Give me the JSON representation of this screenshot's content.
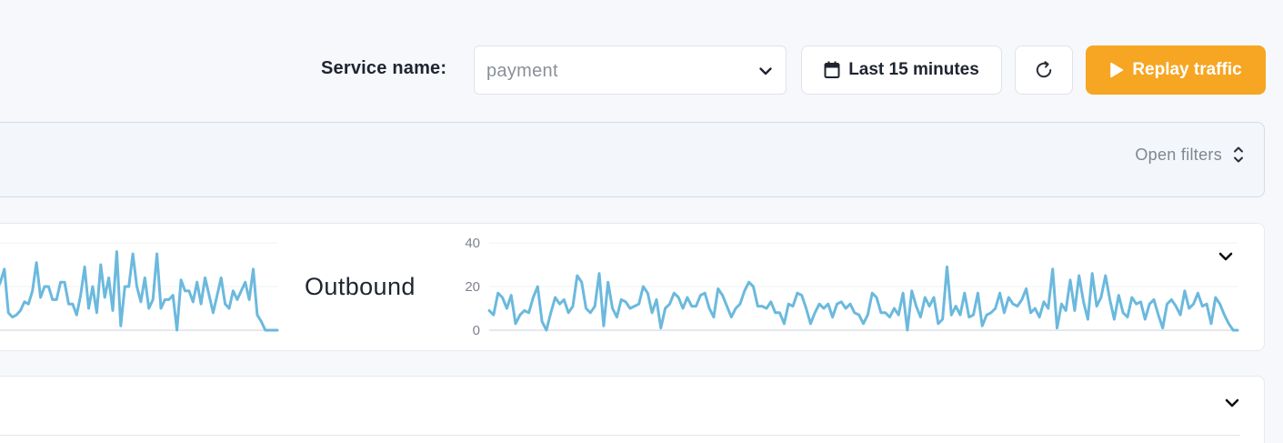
{
  "toolbar": {
    "service_label": "Service name:",
    "service_value": "payment",
    "time_range_label": "Last 15 minutes",
    "replay_label": "Replay traffic"
  },
  "filters": {
    "open_filters_label": "Open filters"
  },
  "colors": {
    "accent": "#f6a623",
    "series_line": "#6bb9dd",
    "background": "#f6f8fb"
  },
  "icons": {
    "service_dropdown": "chevron-down-icon",
    "calendar": "calendar-icon",
    "refresh": "refresh-icon",
    "play": "play-icon",
    "sort": "chevron-up-down-icon",
    "collapse": "chevron-down-icon"
  },
  "traffic": {
    "outbound_label": "Outbound"
  },
  "chart_data": [
    {
      "type": "line",
      "series": [
        {
          "values": [
            18,
            22,
            28,
            8,
            6,
            7,
            9,
            13,
            12,
            18,
            31,
            15,
            20,
            20,
            14,
            14,
            22,
            22,
            12,
            12,
            7,
            16,
            29,
            10,
            20,
            8,
            30,
            15,
            24,
            9,
            36,
            2,
            20,
            20,
            35,
            20,
            13,
            24,
            10,
            14,
            35,
            10,
            14,
            14,
            16,
            0,
            23,
            18,
            18,
            13,
            22,
            12,
            24,
            16,
            8,
            16,
            24,
            12,
            10,
            18,
            14,
            18,
            22,
            14,
            28,
            7,
            4,
            0,
            0,
            0,
            0
          ]
        }
      ],
      "ylim": [
        0,
        40
      ]
    },
    {
      "type": "line",
      "yticks": [
        0,
        20,
        40
      ],
      "ylim": [
        0,
        40
      ],
      "series": [
        {
          "values": [
            9,
            7,
            17,
            15,
            10,
            16,
            3,
            7,
            9,
            8,
            15,
            20,
            4,
            0,
            8,
            15,
            12,
            14,
            8,
            11,
            25,
            22,
            10,
            8,
            11,
            26,
            2,
            22,
            10,
            6,
            14,
            13,
            10,
            11,
            12,
            20,
            17,
            8,
            14,
            1,
            10,
            12,
            17,
            15,
            10,
            15,
            11,
            11,
            16,
            17,
            10,
            6,
            19,
            16,
            11,
            6,
            10,
            12,
            18,
            22,
            20,
            11,
            11,
            10,
            13,
            8,
            8,
            3,
            12,
            11,
            17,
            16,
            10,
            3,
            8,
            12,
            10,
            12,
            6,
            12,
            13,
            10,
            12,
            8,
            7,
            3,
            7,
            17,
            15,
            8,
            8,
            6,
            10,
            7,
            17,
            0,
            18,
            11,
            6,
            15,
            11,
            15,
            3,
            5,
            29,
            7,
            11,
            7,
            17,
            6,
            7,
            17,
            2,
            7,
            8,
            10,
            17,
            8,
            15,
            12,
            11,
            14,
            19,
            8,
            10,
            6,
            13,
            10,
            28,
            1,
            12,
            9,
            23,
            9,
            25,
            13,
            5,
            26,
            11,
            15,
            25,
            14,
            5,
            16,
            8,
            6,
            15,
            12,
            13,
            5,
            12,
            14,
            7,
            1,
            12,
            14,
            11,
            7,
            18,
            10,
            12,
            17,
            11,
            12,
            3,
            15,
            12,
            7,
            3,
            0,
            0
          ]
        }
      ]
    }
  ]
}
